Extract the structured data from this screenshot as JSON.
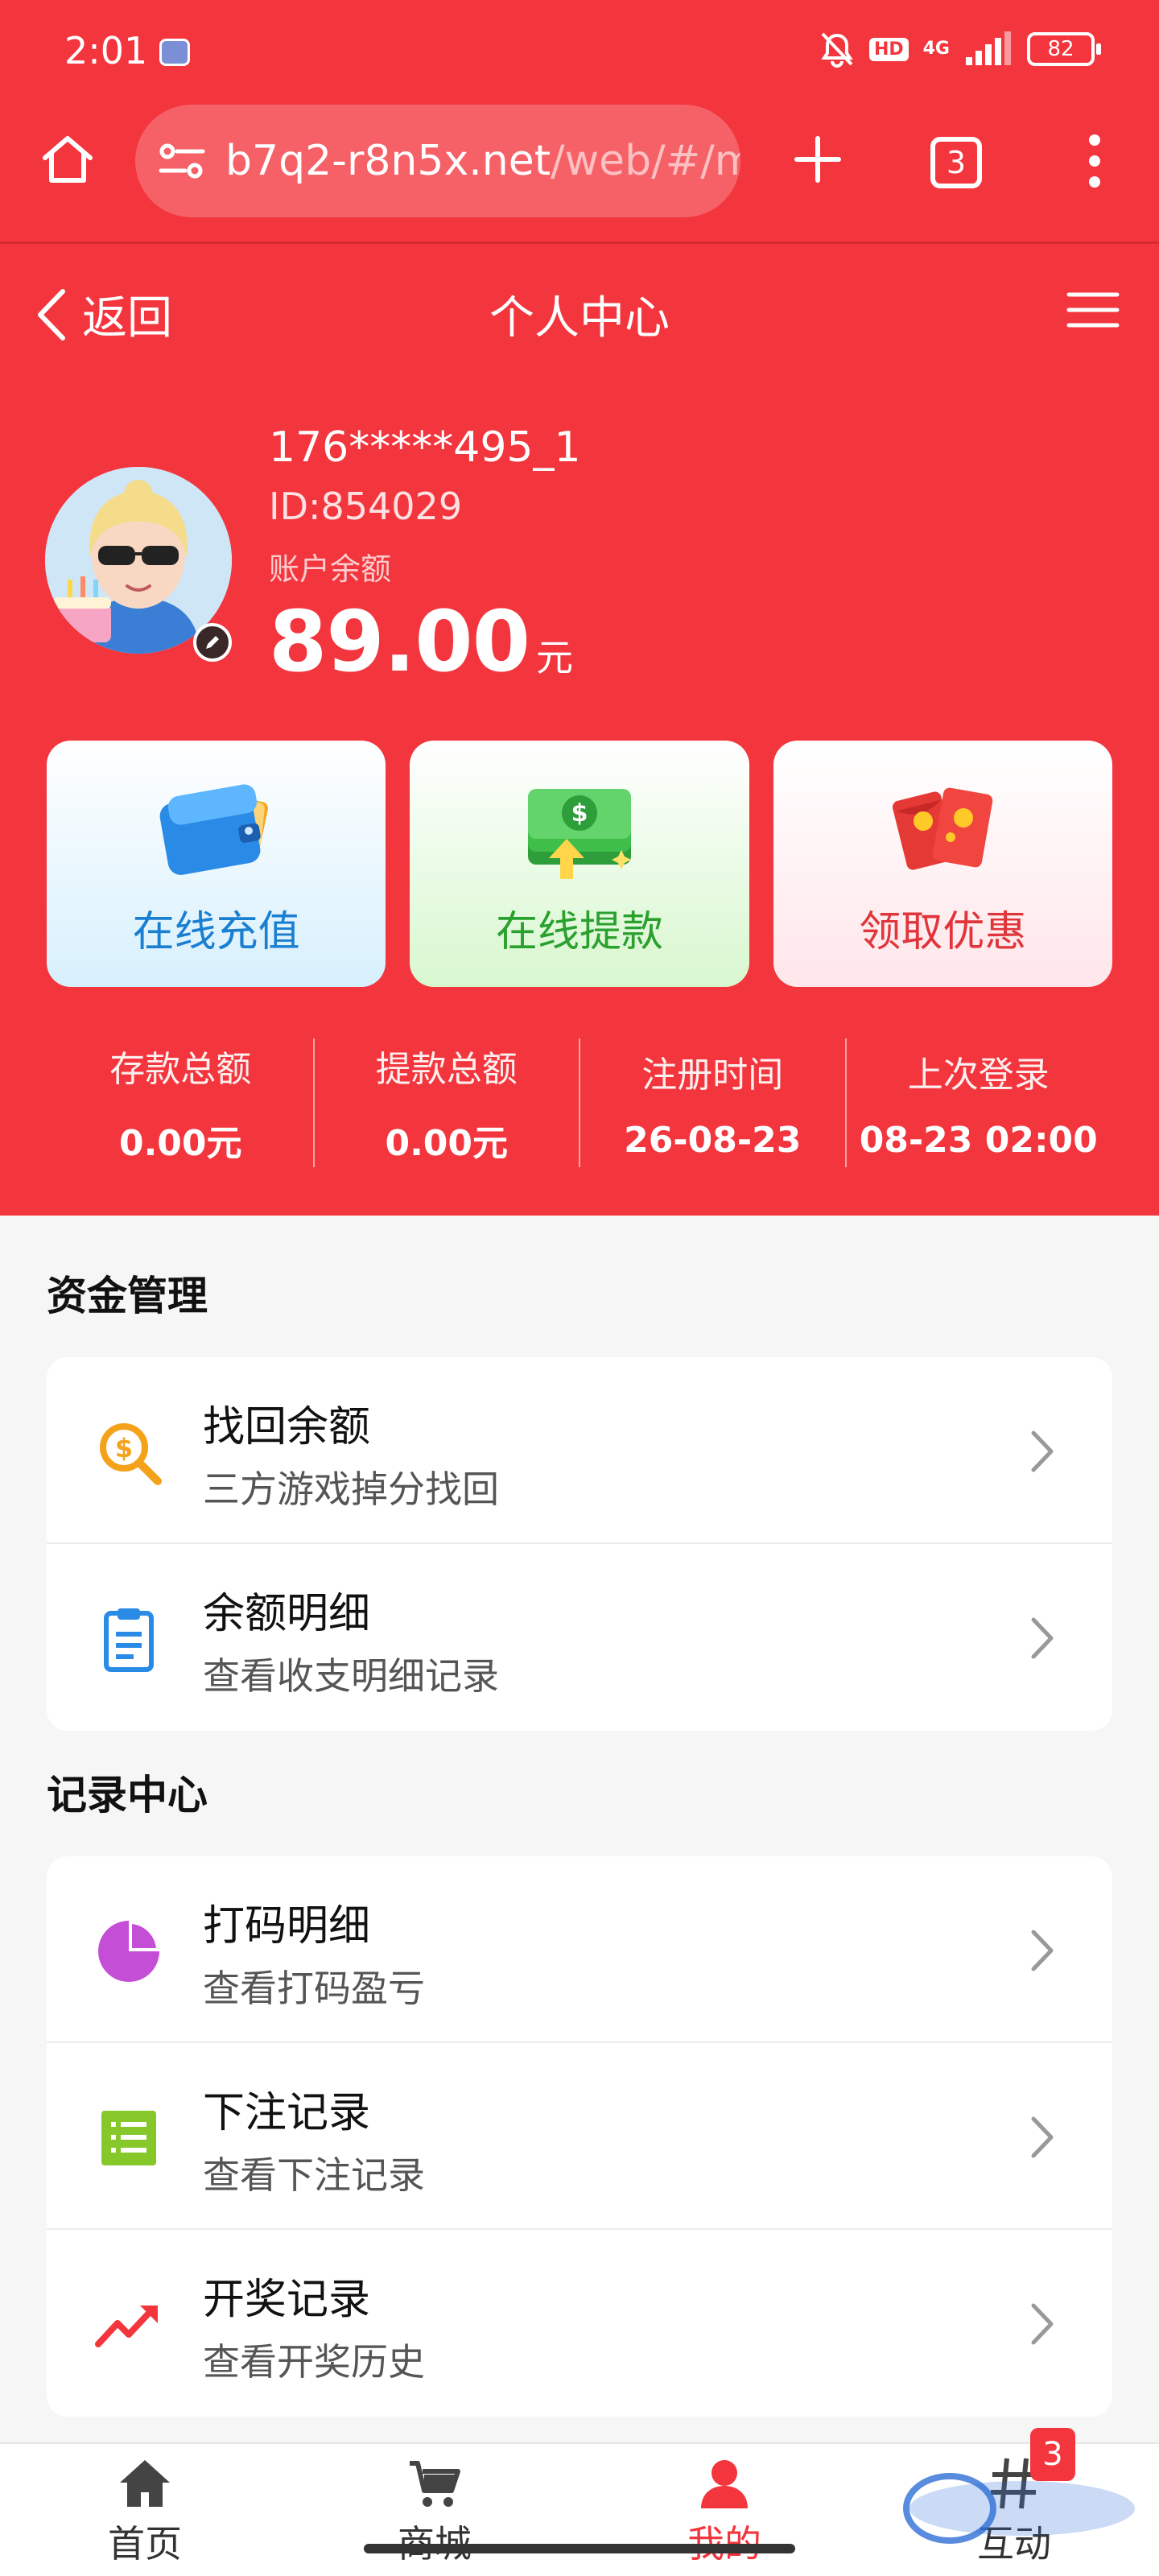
{
  "status_bar": {
    "time": "2:01",
    "hd": "HD",
    "network": "4G",
    "battery": "82"
  },
  "browser": {
    "url_main": "b7q2-r8n5x.net",
    "url_dim": "/web/#/m",
    "tab_count": "3"
  },
  "nav": {
    "back_label": "返回",
    "title": "个人中心"
  },
  "profile": {
    "username": "176*****495_1",
    "user_id": "ID:854029",
    "balance_label": "账户余额",
    "balance": "89.00",
    "balance_unit": "元"
  },
  "actions": [
    {
      "label": "在线充值",
      "icon": "wallet-icon"
    },
    {
      "label": "在线提款",
      "icon": "cash-icon"
    },
    {
      "label": "领取优惠",
      "icon": "red-envelope-icon"
    }
  ],
  "stats": [
    {
      "label": "存款总额",
      "value": "0.00元"
    },
    {
      "label": "提款总额",
      "value": "0.00元"
    },
    {
      "label": "注册时间",
      "value": "26-08-23"
    },
    {
      "label": "上次登录",
      "value": "08-23 02:00"
    }
  ],
  "sections": {
    "funds": {
      "title": "资金管理",
      "items": [
        {
          "title": "找回余额",
          "subtitle": "三方游戏掉分找回",
          "icon": "search-money-icon"
        },
        {
          "title": "余额明细",
          "subtitle": "查看收支明细记录",
          "icon": "clipboard-icon"
        }
      ]
    },
    "records": {
      "title": "记录中心",
      "items": [
        {
          "title": "打码明细",
          "subtitle": "查看打码盈亏",
          "icon": "pie-chart-icon"
        },
        {
          "title": "下注记录",
          "subtitle": "查看下注记录",
          "icon": "list-icon"
        },
        {
          "title": "开奖记录",
          "subtitle": "查看开奖历史",
          "icon": "trend-icon"
        }
      ]
    }
  },
  "bottom_nav": {
    "tabs": [
      {
        "label": "首页",
        "icon": "home-icon"
      },
      {
        "label": "商城",
        "icon": "cart-icon"
      },
      {
        "label": "我的",
        "icon": "user-icon"
      },
      {
        "label": "互动",
        "icon": "hashtag-icon",
        "badge": "3"
      }
    ],
    "active": "我的"
  },
  "colors": {
    "brand_red": "#f3353d",
    "recharge_blue": "#1b7fd1",
    "withdraw_green": "#2aa12f",
    "promo_red": "#e0353b"
  }
}
